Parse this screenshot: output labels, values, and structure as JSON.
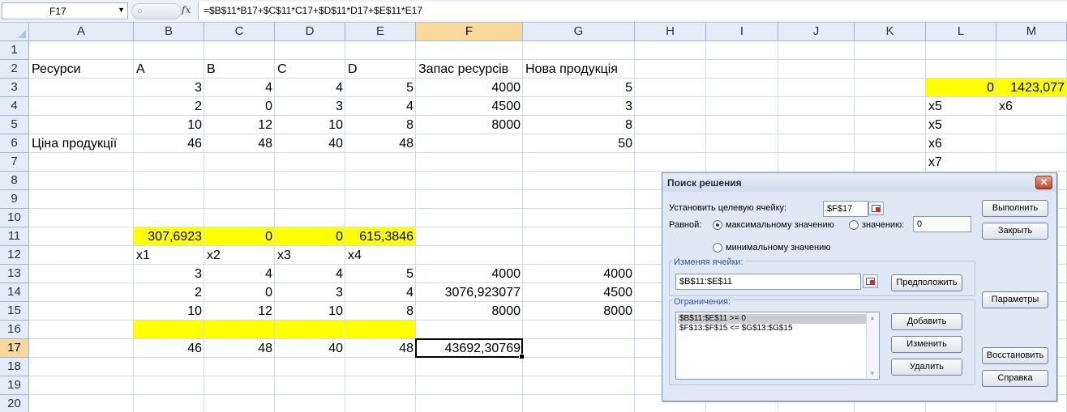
{
  "formula_bar": {
    "name_box": "F17",
    "fx_label": "fx",
    "formula": "=$B$11*B17+$C$11*C17+$D$11*D17+$E$11*E17"
  },
  "columns": [
    "A",
    "B",
    "C",
    "D",
    "E",
    "F",
    "G",
    "H",
    "I",
    "J",
    "K",
    "L",
    "M"
  ],
  "rows": [
    "1",
    "2",
    "3",
    "4",
    "5",
    "6",
    "7",
    "8",
    "9",
    "10",
    "11",
    "12",
    "13",
    "14",
    "15",
    "16",
    "17",
    "18",
    "19",
    "20"
  ],
  "cells": {
    "A2": "Ресурси",
    "B2": "A",
    "C2": "B",
    "D2": "C",
    "E2": "D",
    "F2": "Запас ресурсів",
    "G2": "Нова продукція",
    "B3": "3",
    "C3": "4",
    "D3": "4",
    "E3": "5",
    "F3": "4000",
    "G3": "5",
    "B4": "2",
    "C4": "0",
    "D4": "3",
    "E4": "4",
    "F4": "4500",
    "G4": "3",
    "B5": "10",
    "C5": "12",
    "D5": "10",
    "E5": "8",
    "F5": "8000",
    "G5": "8",
    "A6": "Ціна продукції",
    "B6": "46",
    "C6": "48",
    "D6": "40",
    "E6": "48",
    "G6": "50",
    "B11": "307,6923",
    "C11": "0",
    "D11": "0",
    "E11": "615,3846",
    "B12": "x1",
    "C12": "x2",
    "D12": "x3",
    "E12": "x4",
    "B13": "3",
    "C13": "4",
    "D13": "4",
    "E13": "5",
    "F13": "4000",
    "G13": "4000",
    "B14": "2",
    "C14": "0",
    "D14": "3",
    "E14": "4",
    "F14": "3076,923077",
    "G14": "4500",
    "B15": "10",
    "C15": "12",
    "D15": "10",
    "E15": "8",
    "F15": "8000",
    "G15": "8000",
    "B17": "46",
    "C17": "48",
    "D17": "40",
    "E17": "48",
    "F17": "43692,30769",
    "L3": "0",
    "M3": "1423,077",
    "L4": "x5",
    "M4": "x6",
    "L5": "x5",
    "L6": "x6",
    "L7": "x7"
  },
  "active_cell": "F17",
  "highlight_color": "#ffff00",
  "dialog": {
    "title": "Поиск решения",
    "target_label": "Установить целевую ячейку:",
    "target_value": "$F$17",
    "equal_label": "Равной:",
    "opt_max": "максимальному значению",
    "opt_value": "значению:",
    "opt_value_input": "0",
    "opt_min": "минимальному значению",
    "changing_label": "Изменяя ячейки:",
    "changing_value": "$B$11:$E$11",
    "guess_button": "Предположить",
    "constraints_label": "Ограничения:",
    "constraints": [
      "$B$11:$E$11 >= 0",
      "$F$13:$F$15 <= $G$13:$G$15"
    ],
    "add_button": "Добавить",
    "change_button": "Изменить",
    "delete_button": "Удалить",
    "solve_button": "Выполнить",
    "close_button": "Закрыть",
    "options_button": "Параметры",
    "reset_button": "Восстановить",
    "help_button": "Справка",
    "close_icon_glyph": "✕"
  }
}
